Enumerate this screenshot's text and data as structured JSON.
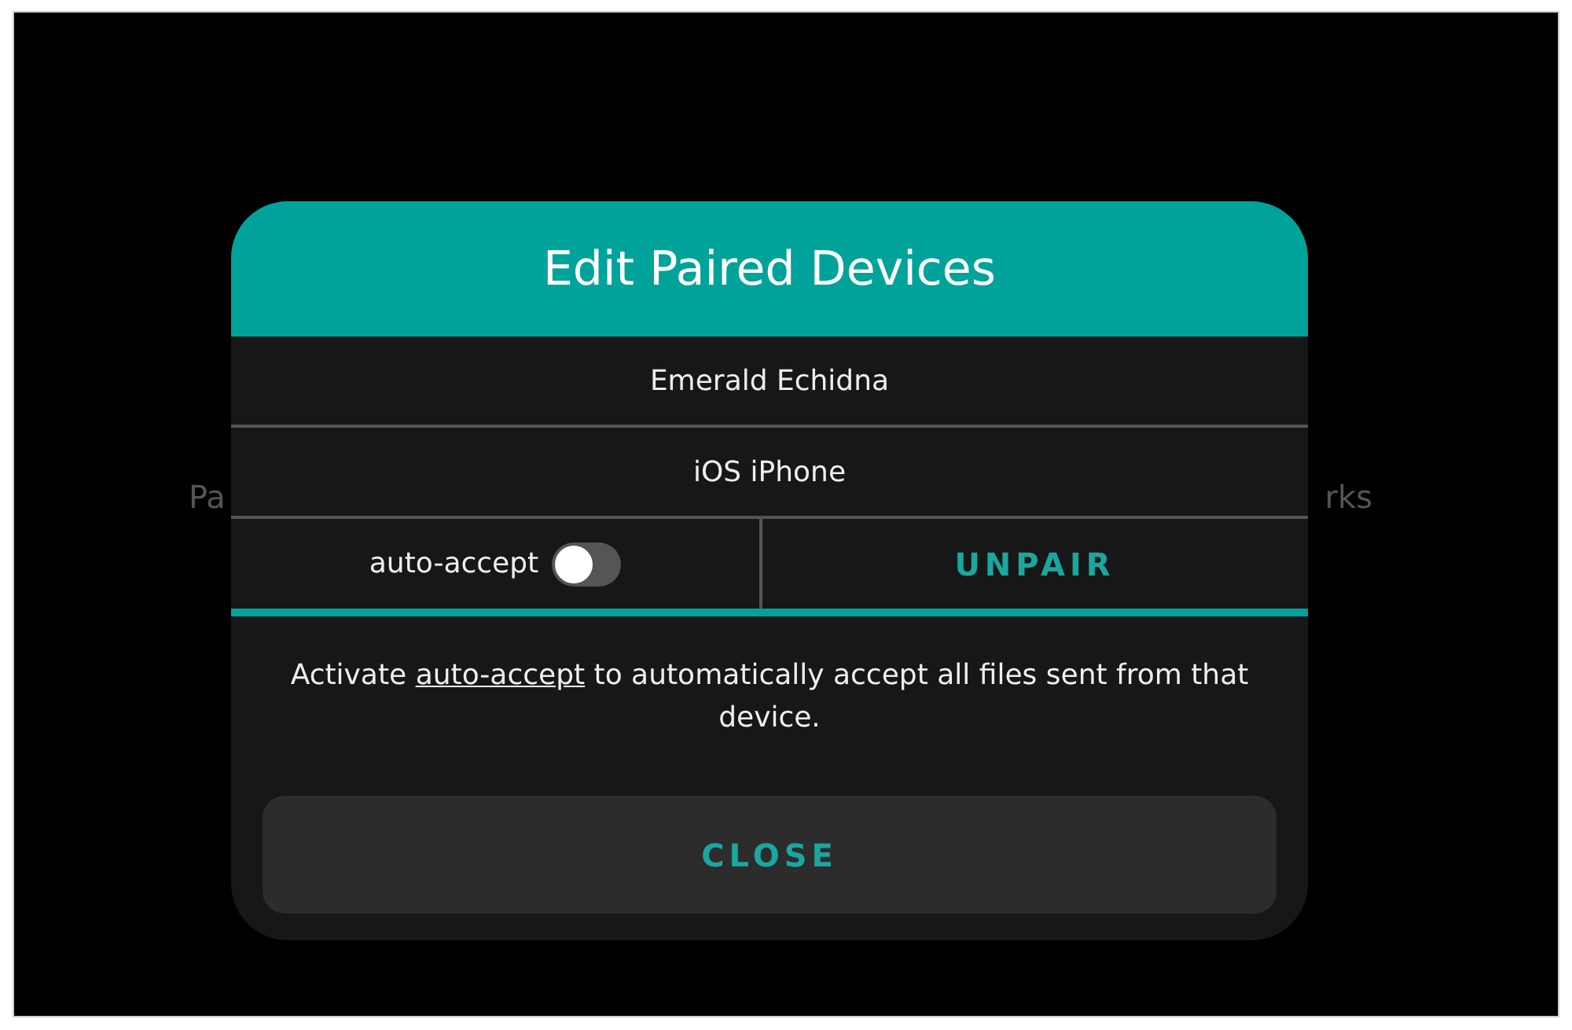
{
  "background": {
    "left_label": "Pa",
    "right_label": "rks"
  },
  "dialog": {
    "title": "Edit Paired Devices",
    "device_name": "Emerald Echidna",
    "device_type": "iOS iPhone",
    "auto_accept": {
      "label": "auto-accept",
      "on": false
    },
    "unpair_button": "UNPAIR",
    "hint": "Activate **auto-accept** to automatically accept all files sent from that device.",
    "close_button": "CLOSE"
  }
}
